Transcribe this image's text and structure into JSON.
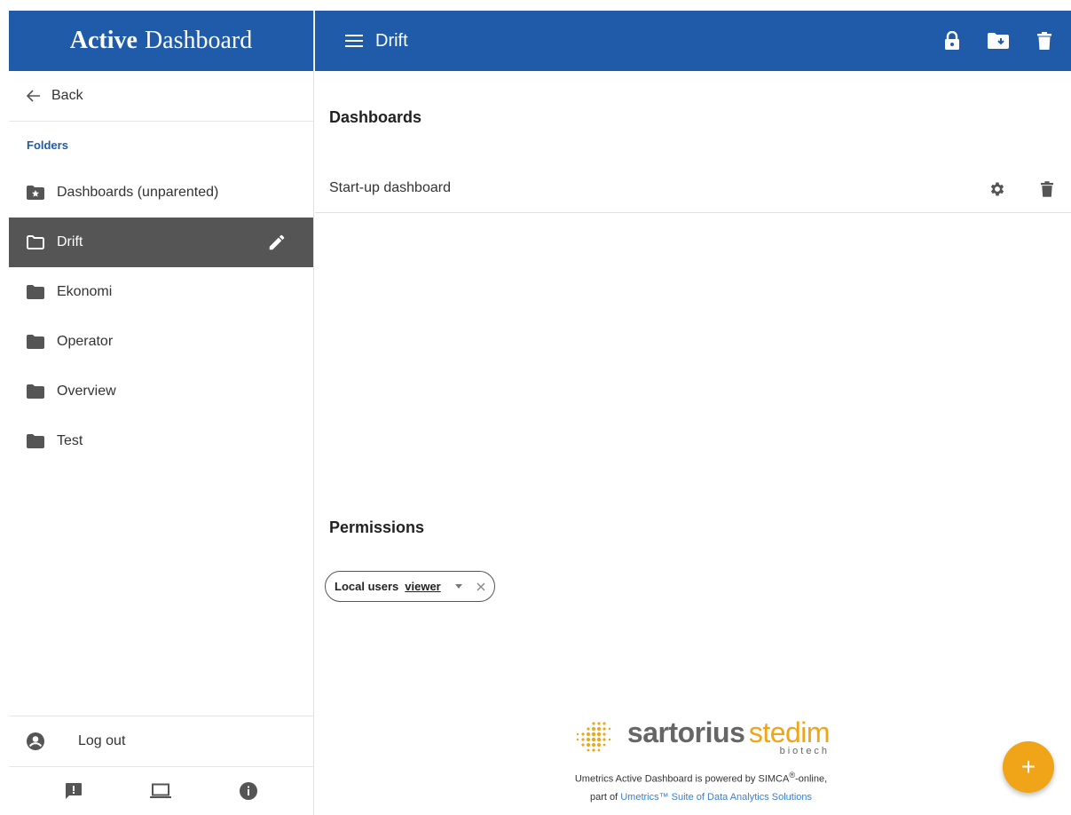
{
  "app": {
    "title_bold": "Active",
    "title_rest": "Dashboard"
  },
  "sidebar": {
    "back_label": "Back",
    "section_label": "Folders",
    "folders": [
      {
        "label": "Dashboards (unparented)",
        "icon": "folder-star-icon"
      },
      {
        "label": "Drift",
        "icon": "folder-outline-icon",
        "active": true
      },
      {
        "label": "Ekonomi",
        "icon": "folder-icon"
      },
      {
        "label": "Operator",
        "icon": "folder-icon"
      },
      {
        "label": "Overview",
        "icon": "folder-icon"
      },
      {
        "label": "Test",
        "icon": "folder-icon"
      }
    ],
    "logout_label": "Log out",
    "footer_icons": [
      "feedback-icon",
      "laptop-icon",
      "info-icon"
    ]
  },
  "topbar": {
    "title": "Drift",
    "actions": [
      "lock-icon",
      "folder-download-icon",
      "delete-icon"
    ]
  },
  "main": {
    "dashboards_heading": "Dashboards",
    "dashboards": [
      {
        "label": "Start-up dashboard"
      }
    ],
    "permissions_heading": "Permissions",
    "permission_chip": {
      "group": "Local users",
      "role": "viewer"
    }
  },
  "footer": {
    "brand_main": "sartorius",
    "brand_accent": "stedim",
    "brand_sub": "biotech",
    "powered_text": "Umetrics Active Dashboard is powered by SIMCA",
    "powered_sup": "®",
    "powered_suffix": "-online,",
    "part_of": "part of",
    "suite_link": "Umetrics™ Suite of Data Analytics Solutions"
  },
  "fab": {
    "label": "+"
  },
  "colors": {
    "primary": "#1f5ba8",
    "accent": "#f0a418",
    "active_item": "#555555"
  }
}
